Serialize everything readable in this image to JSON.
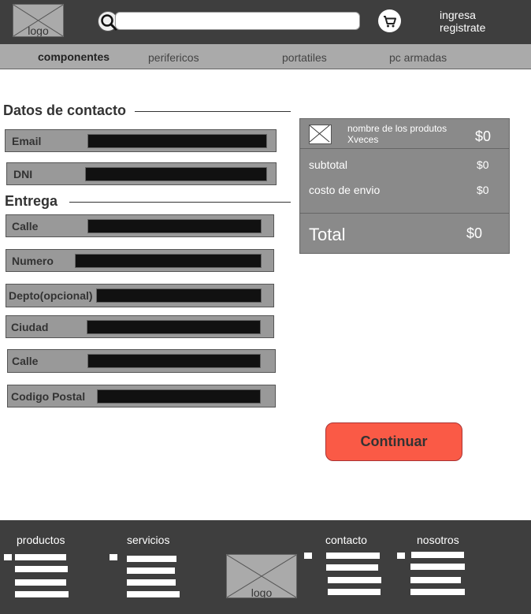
{
  "header": {
    "logo_label": "logo",
    "search": {
      "value": "",
      "placeholder": ""
    },
    "auth": {
      "login": "ingresa",
      "register": "registrate"
    }
  },
  "nav": {
    "items": [
      {
        "label": "componentes",
        "active": true
      },
      {
        "label": "perifericos",
        "active": false
      },
      {
        "label": "portatiles",
        "active": false
      },
      {
        "label": "pc armadas",
        "active": false
      }
    ]
  },
  "form": {
    "contact_title": "Datos de contacto",
    "delivery_title": "Entrega",
    "fields": {
      "email": "Email",
      "dni": "DNI",
      "calle1": "Calle",
      "numero": "Numero",
      "depto": "Depto(opcional)",
      "ciudad": "Ciudad",
      "calle2": "Calle",
      "codigo_postal": "Codigo Postal"
    }
  },
  "summary": {
    "product_name": "nombre de los produtos",
    "product_qty": "Xveces",
    "product_price": "$0",
    "subtotal_label": "subtotal",
    "subtotal_value": "$0",
    "shipping_label": "costo de envio",
    "shipping_value": "$0",
    "total_label": "Total",
    "total_value": "$0"
  },
  "continue_label": "Continuar",
  "footer": {
    "products": "productos",
    "services": "servicios",
    "logo_label": "logo",
    "contact": "contacto",
    "about": "nosotros"
  },
  "colors": {
    "dark_bg": "#3e3e3e",
    "nav_bg": "#aaaaaa",
    "field_bg": "#999999",
    "input_bg": "#111111",
    "summary_bg": "#8a8a8a",
    "accent": "#fa5a46"
  },
  "icons": {
    "search": "search-icon",
    "cart": "cart-icon",
    "product_image": "image-placeholder-icon"
  }
}
